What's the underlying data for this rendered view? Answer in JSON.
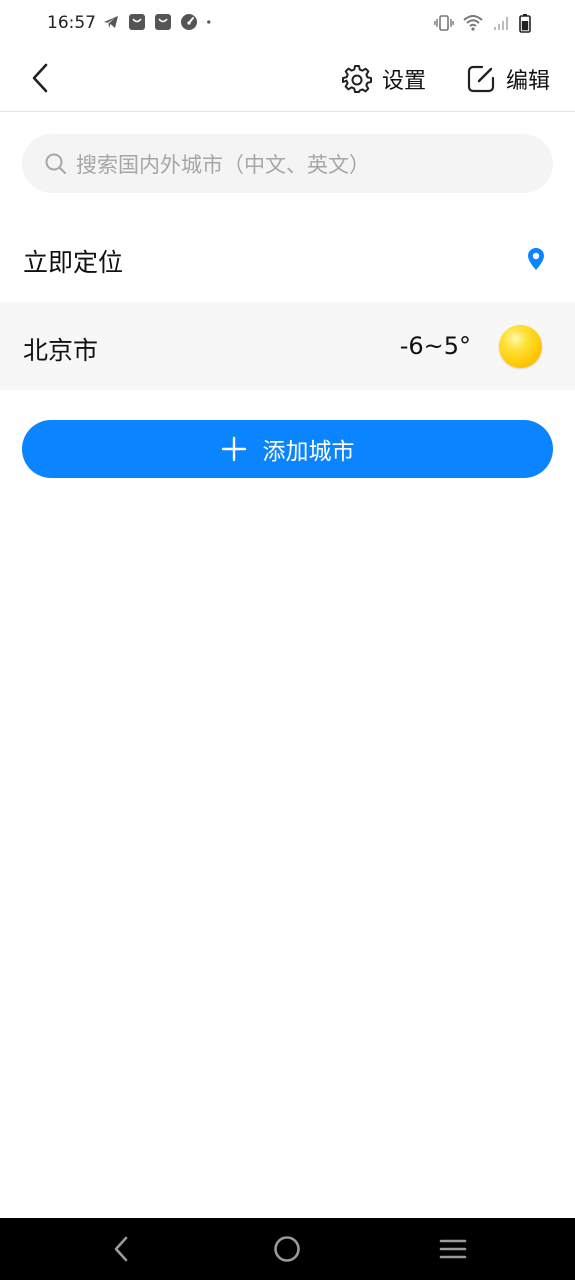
{
  "status_bar": {
    "time": "16:57",
    "left_icons": [
      "telegram-icon",
      "shopping-bag-icon",
      "shopping-bag-icon",
      "speedometer-icon",
      "dot-icon"
    ],
    "right_icons": [
      "vibrate-icon",
      "wifi-icon",
      "signal-icon",
      "battery-icon"
    ]
  },
  "header": {
    "settings_label": "设置",
    "edit_label": "编辑"
  },
  "search": {
    "placeholder": "搜索国内外城市（中文、英文）"
  },
  "locate": {
    "label": "立即定位"
  },
  "cities": [
    {
      "name": "北京市",
      "temp": "-6~5°",
      "weather_icon": "sun-icon"
    }
  ],
  "add_city": {
    "label": "添加城市"
  },
  "colors": {
    "accent": "#0a84ff",
    "row_bg": "#f7f7f7",
    "search_bg": "#f4f4f4"
  }
}
